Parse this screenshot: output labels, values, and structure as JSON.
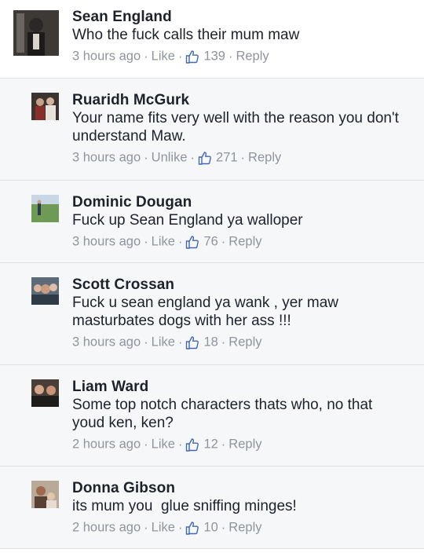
{
  "comments": [
    {
      "name": "Sean England",
      "text": "Who the fuck calls their mum maw",
      "time": "3 hours ago",
      "action": "Like",
      "likes": "139",
      "reply": "Reply"
    },
    {
      "name": "Ruaridh McGurk",
      "text": "Your name fits very well with the reason you don't understand Maw.",
      "time": "3 hours ago",
      "action": "Unlike",
      "likes": "271",
      "reply": "Reply"
    },
    {
      "name": "Dominic Dougan",
      "text": "Fuck up Sean England ya walloper",
      "time": "3 hours ago",
      "action": "Like",
      "likes": "76",
      "reply": "Reply"
    },
    {
      "name": "Scott Crossan",
      "text": "Fuck u sean england ya wank , yer maw masturbates dogs with her ass !!!",
      "time": "3 hours ago",
      "action": "Like",
      "likes": "18",
      "reply": "Reply"
    },
    {
      "name": "Liam Ward",
      "text": "Some top notch characters thats who, no that youd ken, ken?",
      "time": "2 hours ago",
      "action": "Like",
      "likes": "12",
      "reply": "Reply"
    },
    {
      "name": "Donna Gibson",
      "text": "its mum you  glue sniffing minges!",
      "time": "2 hours ago",
      "action": "Like",
      "likes": "10",
      "reply": "Reply"
    }
  ],
  "separator": "·",
  "colors": {
    "name": "#1d2129",
    "meta": "#90949c",
    "like_icon": "#4267b2",
    "reply_bg": "#f6f7f9",
    "divider": "#e1e2e6"
  }
}
